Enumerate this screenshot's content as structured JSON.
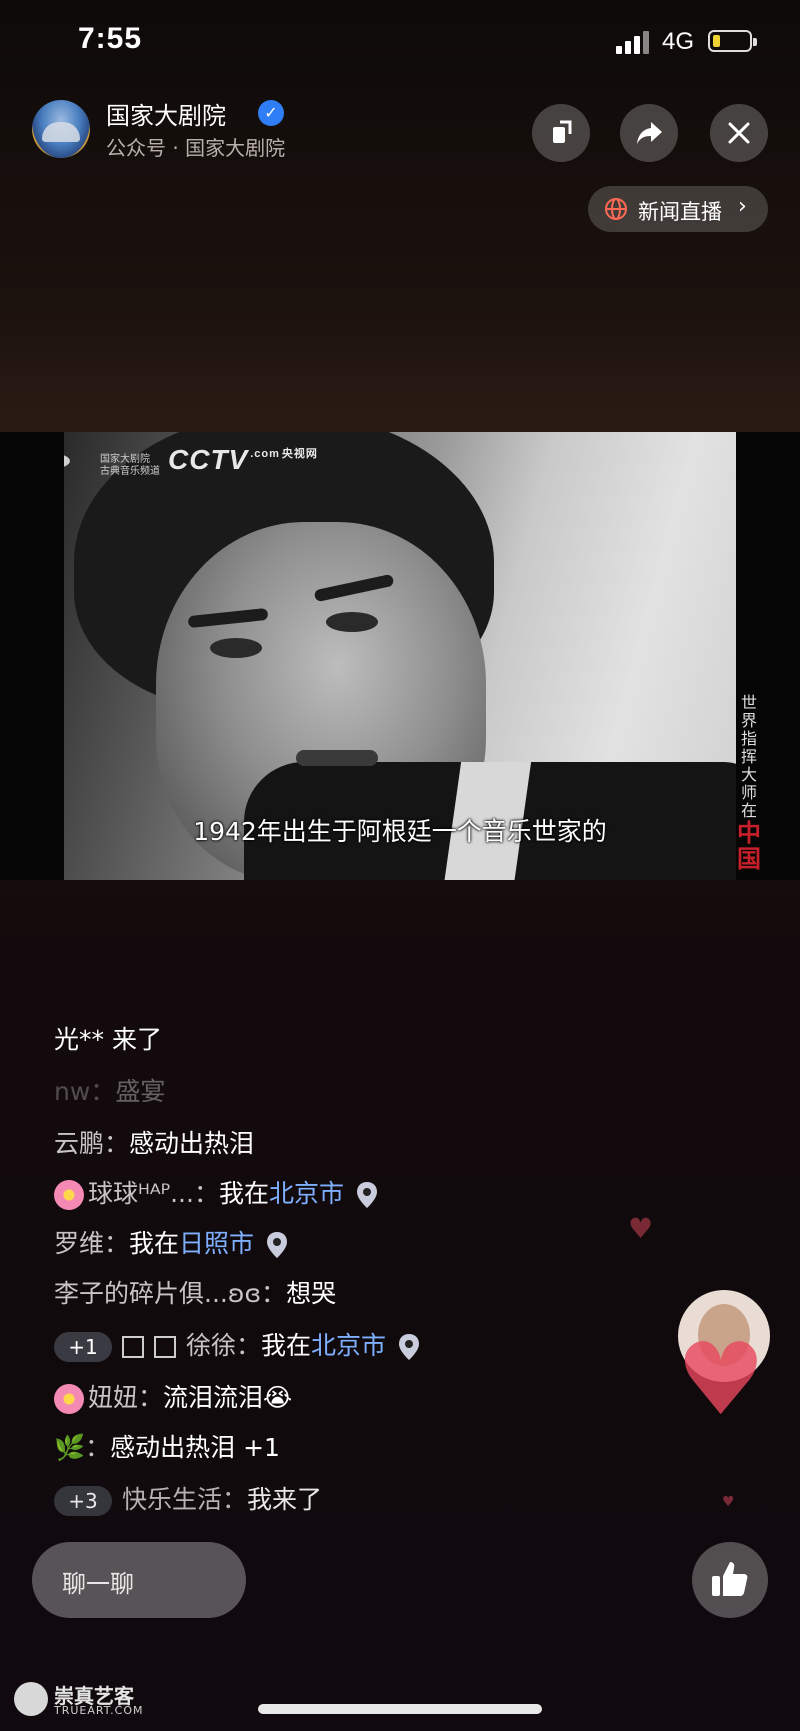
{
  "status": {
    "time": "7:55",
    "network": "4G"
  },
  "header": {
    "account_name": "国家大剧院",
    "account_sub": "公众号 · 国家大剧院",
    "news_button": "新闻直播"
  },
  "video": {
    "logo_cctv": "CCTV",
    "logo_cctv_com": ".com",
    "logo_cctv_cn": "央视网",
    "logo_ncpa_line1": "国家大剧院",
    "logo_ncpa_line2": "古典音乐频道",
    "subtitle": "1942年出生于阿根廷一个音乐世家的",
    "side_title": "世界指挥大师在",
    "side_title_red": "中国"
  },
  "comments": [
    {
      "nick": "光**",
      "text": " 来了"
    },
    {
      "nick": "nw",
      "text": "盛宴"
    },
    {
      "nick": "云鹏",
      "text": "感动出热泪"
    },
    {
      "nick": "球球ᴴᴬᴾ...",
      "text": "我在",
      "loc": "北京市"
    },
    {
      "nick": "罗维",
      "text": "我在",
      "loc": "日照市"
    },
    {
      "nick": "李子的碎片俱...",
      "text": "想哭"
    },
    {
      "badge": "+1",
      "nick": "徐徐",
      "text": "我在",
      "loc": "北京市"
    },
    {
      "nick": "妞妞",
      "text": "流泪流泪"
    },
    {
      "nick": "",
      "text": "感动出热泪 +1"
    },
    {
      "badge": "+3",
      "nick": "快乐生活",
      "text": "我来了"
    }
  ],
  "footer": {
    "chat_placeholder": "聊一聊",
    "watermark_title": "崇真艺客",
    "watermark_url": "TRUEART.COM"
  },
  "colors": {
    "accent_blue": "#2f7ef5",
    "location_blue": "#7fb0ff",
    "heart_red": "#e8485e"
  },
  "icons": [
    "signal-icon",
    "battery-icon",
    "verified-icon",
    "minimize-icon",
    "share-icon",
    "close-icon",
    "globe-icon",
    "location-pin-icon",
    "thumbs-up-icon",
    "heart-icon"
  ]
}
